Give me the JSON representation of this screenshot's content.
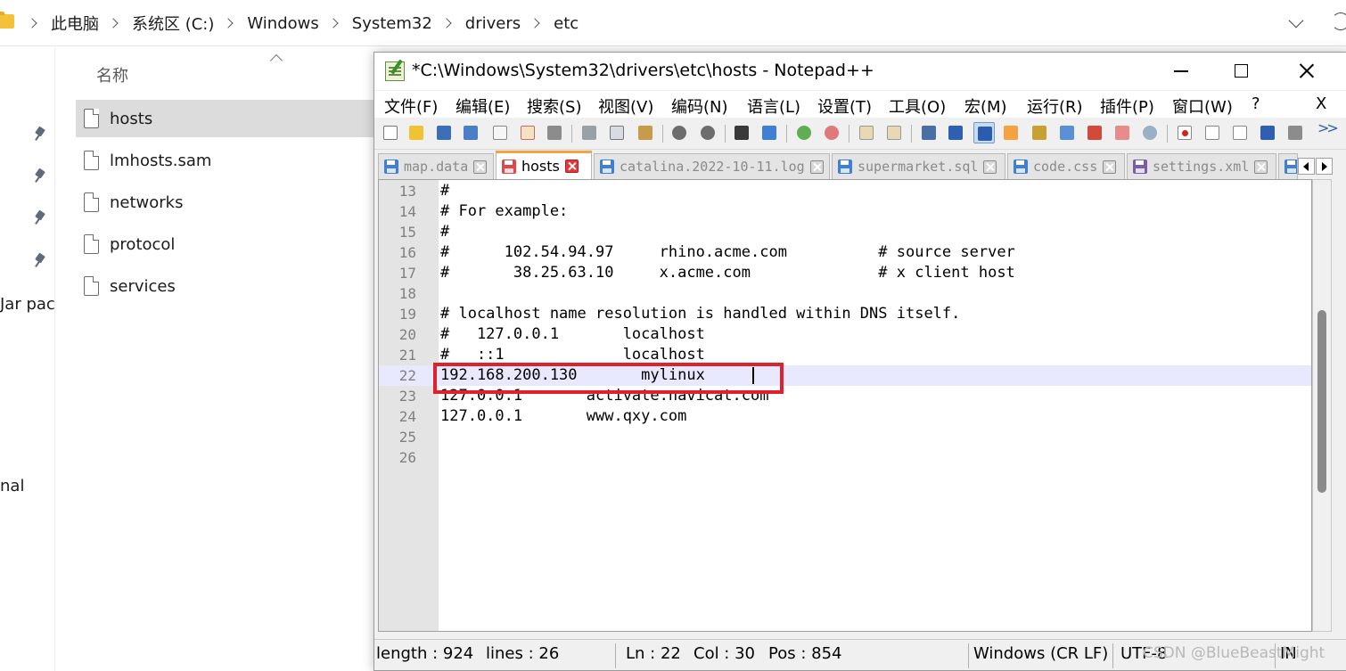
{
  "explorer": {
    "breadcrumb": [
      "此电脑",
      "系统区 (C:)",
      "Windows",
      "System32",
      "drivers",
      "etc"
    ],
    "column_header": "名称",
    "nav_labels": [
      "Jar pac",
      "nal"
    ],
    "files": [
      {
        "name": "hosts",
        "selected": true
      },
      {
        "name": "lmhosts.sam",
        "selected": false
      },
      {
        "name": "networks",
        "selected": false
      },
      {
        "name": "protocol",
        "selected": false
      },
      {
        "name": "services",
        "selected": false
      }
    ]
  },
  "notepad": {
    "title": "*C:\\Windows\\System32\\drivers\\etc\\hosts - Notepad++",
    "menu": [
      "文件(F)",
      "编辑(E)",
      "搜索(S)",
      "视图(V)",
      "编码(N)",
      "语言(L)",
      "设置(T)",
      "工具(O)",
      "宏(M)",
      "运行(R)",
      "插件(P)",
      "窗口(W)",
      "?"
    ],
    "menu_close": "X",
    "tabs": [
      {
        "name": "map.data",
        "active": false,
        "color": "#3f7fd6"
      },
      {
        "name": "hosts",
        "active": true,
        "color": "#e04848"
      },
      {
        "name": "catalina.2022-10-11.log",
        "active": false,
        "color": "#3f7fd6"
      },
      {
        "name": "supermarket.sql",
        "active": false,
        "color": "#3f7fd6"
      },
      {
        "name": "code.css",
        "active": false,
        "color": "#3f7fd6"
      },
      {
        "name": "settings.xml",
        "active": false,
        "color": "#7a5fa8"
      }
    ],
    "lines": [
      {
        "n": "13",
        "text": "#"
      },
      {
        "n": "14",
        "text": "# For example:"
      },
      {
        "n": "15",
        "text": "#"
      },
      {
        "n": "16",
        "text": "#      102.54.94.97     rhino.acme.com          # source server"
      },
      {
        "n": "17",
        "text": "#       38.25.63.10     x.acme.com              # x client host"
      },
      {
        "n": "18",
        "text": ""
      },
      {
        "n": "19",
        "text": "# localhost name resolution is handled within DNS itself."
      },
      {
        "n": "20",
        "text": "#   127.0.0.1       localhost"
      },
      {
        "n": "21",
        "text": "#   ::1             localhost"
      },
      {
        "n": "22",
        "text": "192.168.200.130       mylinux"
      },
      {
        "n": "23",
        "text": "127.0.0.1       activate.navicat.com"
      },
      {
        "n": "24",
        "text": "127.0.0.1       www.qxy.com"
      },
      {
        "n": "25",
        "text": ""
      },
      {
        "n": "26",
        "text": ""
      }
    ],
    "current_line": "22",
    "status": {
      "length": "length : 924",
      "lines": "lines : 26",
      "ln": "Ln : 22",
      "col": "Col : 30",
      "pos": "Pos : 854",
      "eol": "Windows (CR LF)",
      "encoding": "UTF-8",
      "mode": "IN"
    },
    "watermark": "CSDN @BlueBeastMight"
  },
  "colors": {
    "accent_tab": "#f4a340",
    "highlight_box": "#e0202a",
    "current_line_bg": "#e8e8ff"
  }
}
